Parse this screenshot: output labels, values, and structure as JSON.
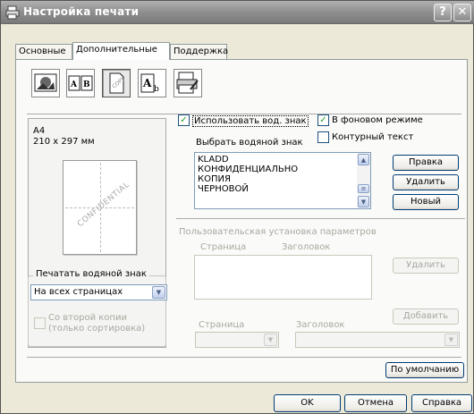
{
  "window": {
    "title": "Настройка печати",
    "help_glyph": "?",
    "close_glyph": "✕"
  },
  "tabs": [
    {
      "label": "Основные",
      "active": false
    },
    {
      "label": "Дополнительные",
      "active": true
    },
    {
      "label": "Поддержка",
      "active": false
    }
  ],
  "toolbar_icons": [
    "quality-icon",
    "duplex-icon",
    "watermark-icon",
    "page-setup-icon",
    "device-options-icon"
  ],
  "preview": {
    "paper": "A4",
    "size": "210 x 297 мм",
    "watermark_text": "CONFIDENTIAL"
  },
  "print_watermark": {
    "legend": "Печатать водяной знак",
    "selected": "На всех страницах",
    "second_copy_label": "Со второй копии (только сортировка)",
    "second_copy_checked": false
  },
  "watermark": {
    "use_label": "Использовать вод. знак",
    "use_checked": true,
    "background_label": "В фоновом режиме",
    "background_checked": true,
    "outline_label": "Контурный текст",
    "outline_checked": false,
    "choose_label": "Выбрать водяной знак",
    "items": [
      "KLADD",
      "КОНФИДЕНЦИАЛЬНО",
      "КОПИЯ",
      "ЧЕРНОВОЙ"
    ],
    "edit_button": "Правка",
    "delete_button": "Удалить",
    "new_button": "Новый"
  },
  "custom": {
    "title": "Пользовательская установка параметров",
    "page_col": "Страница",
    "header_col": "Заголовок",
    "delete_button": "Удалить",
    "add_button": "Добавить",
    "page_label": "Страница",
    "header_label": "Заголовок"
  },
  "buttons": {
    "default": "По умолчанию",
    "ok": "OK",
    "cancel": "Отмена",
    "help": "Справка"
  },
  "colors": {
    "titlebar": "#8e8e8e",
    "dialog": "#ece9d8",
    "check": "#21a121"
  }
}
